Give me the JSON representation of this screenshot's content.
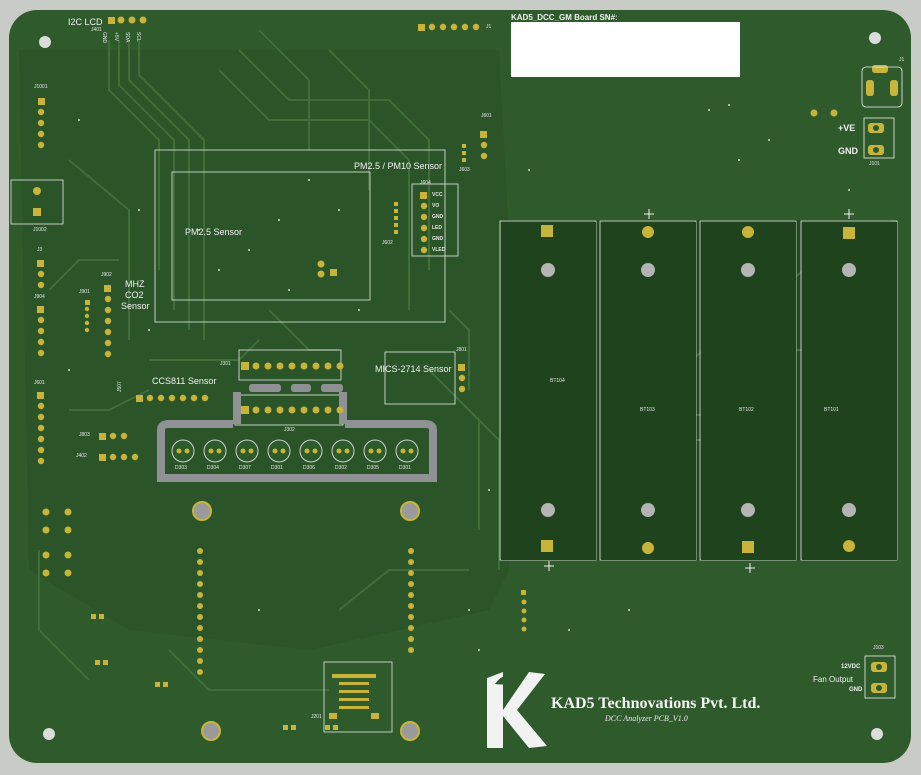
{
  "board": {
    "serial_label": "KAD5_DCC_GM Board SN#:",
    "company": "KAD5 Technovations Pvt. Ltd.",
    "product": "DCC Analyzer PCB_V1.0",
    "logo_text": "KAD5"
  },
  "colors": {
    "background": "#c9ccc6",
    "board": "#2f5a2c",
    "copper_pour": "#274e26",
    "trace": "#3f6e3a",
    "pad": "#c8b43a",
    "silkscreen": "#f2f2f2",
    "hole": "#dcdcdc"
  },
  "labels": {
    "i2c_lcd": "I2C LCD",
    "j401": "J401",
    "gnd": "GND",
    "v5": "+5V",
    "sda": "SDA",
    "scl": "SCL",
    "j1": "J1",
    "j1001": "J1001",
    "j1002": "J1002",
    "j3": "J3",
    "j904": "J904",
    "j601": "J601",
    "j902": "J902",
    "j901": "J901",
    "mhz_line1": "MHZ",
    "mhz_line2": "CO2",
    "mhz_line3": "Sensor",
    "pm25": "PM2.5 Sensor",
    "pm_header": "PM2.5 / PM10 Sensor",
    "j601b": "J601",
    "j603": "J603",
    "j604": "J604",
    "j602": "J602",
    "vcc": "VCC",
    "vo": "VO",
    "gnd2": "GND",
    "led": "LED",
    "gnd3": "GND",
    "vled": "VLED",
    "ccs811": "CCS811 Sensor",
    "j507": "J507",
    "j301": "J301",
    "j302": "J302",
    "mics": "MICS-2714 Sensor",
    "j801": "J801",
    "j803": "J803",
    "j402": "J402",
    "d303": "D303",
    "d304": "D304",
    "d307": "D307",
    "d301_a": "D301",
    "d306": "D306",
    "d302": "D302",
    "d305": "D305",
    "d301": "D301",
    "bt104": "BT104",
    "bt103": "BT103",
    "bt102": "BT102",
    "bt101": "BT101",
    "plus_ve": "+VE",
    "gnd_pwr": "GND",
    "j101": "J101",
    "j1_corner": "J1",
    "j103": "J103",
    "v12": "12VDC",
    "fan": "Fan Output",
    "gnd_fan": "GND",
    "j201": "J201"
  }
}
